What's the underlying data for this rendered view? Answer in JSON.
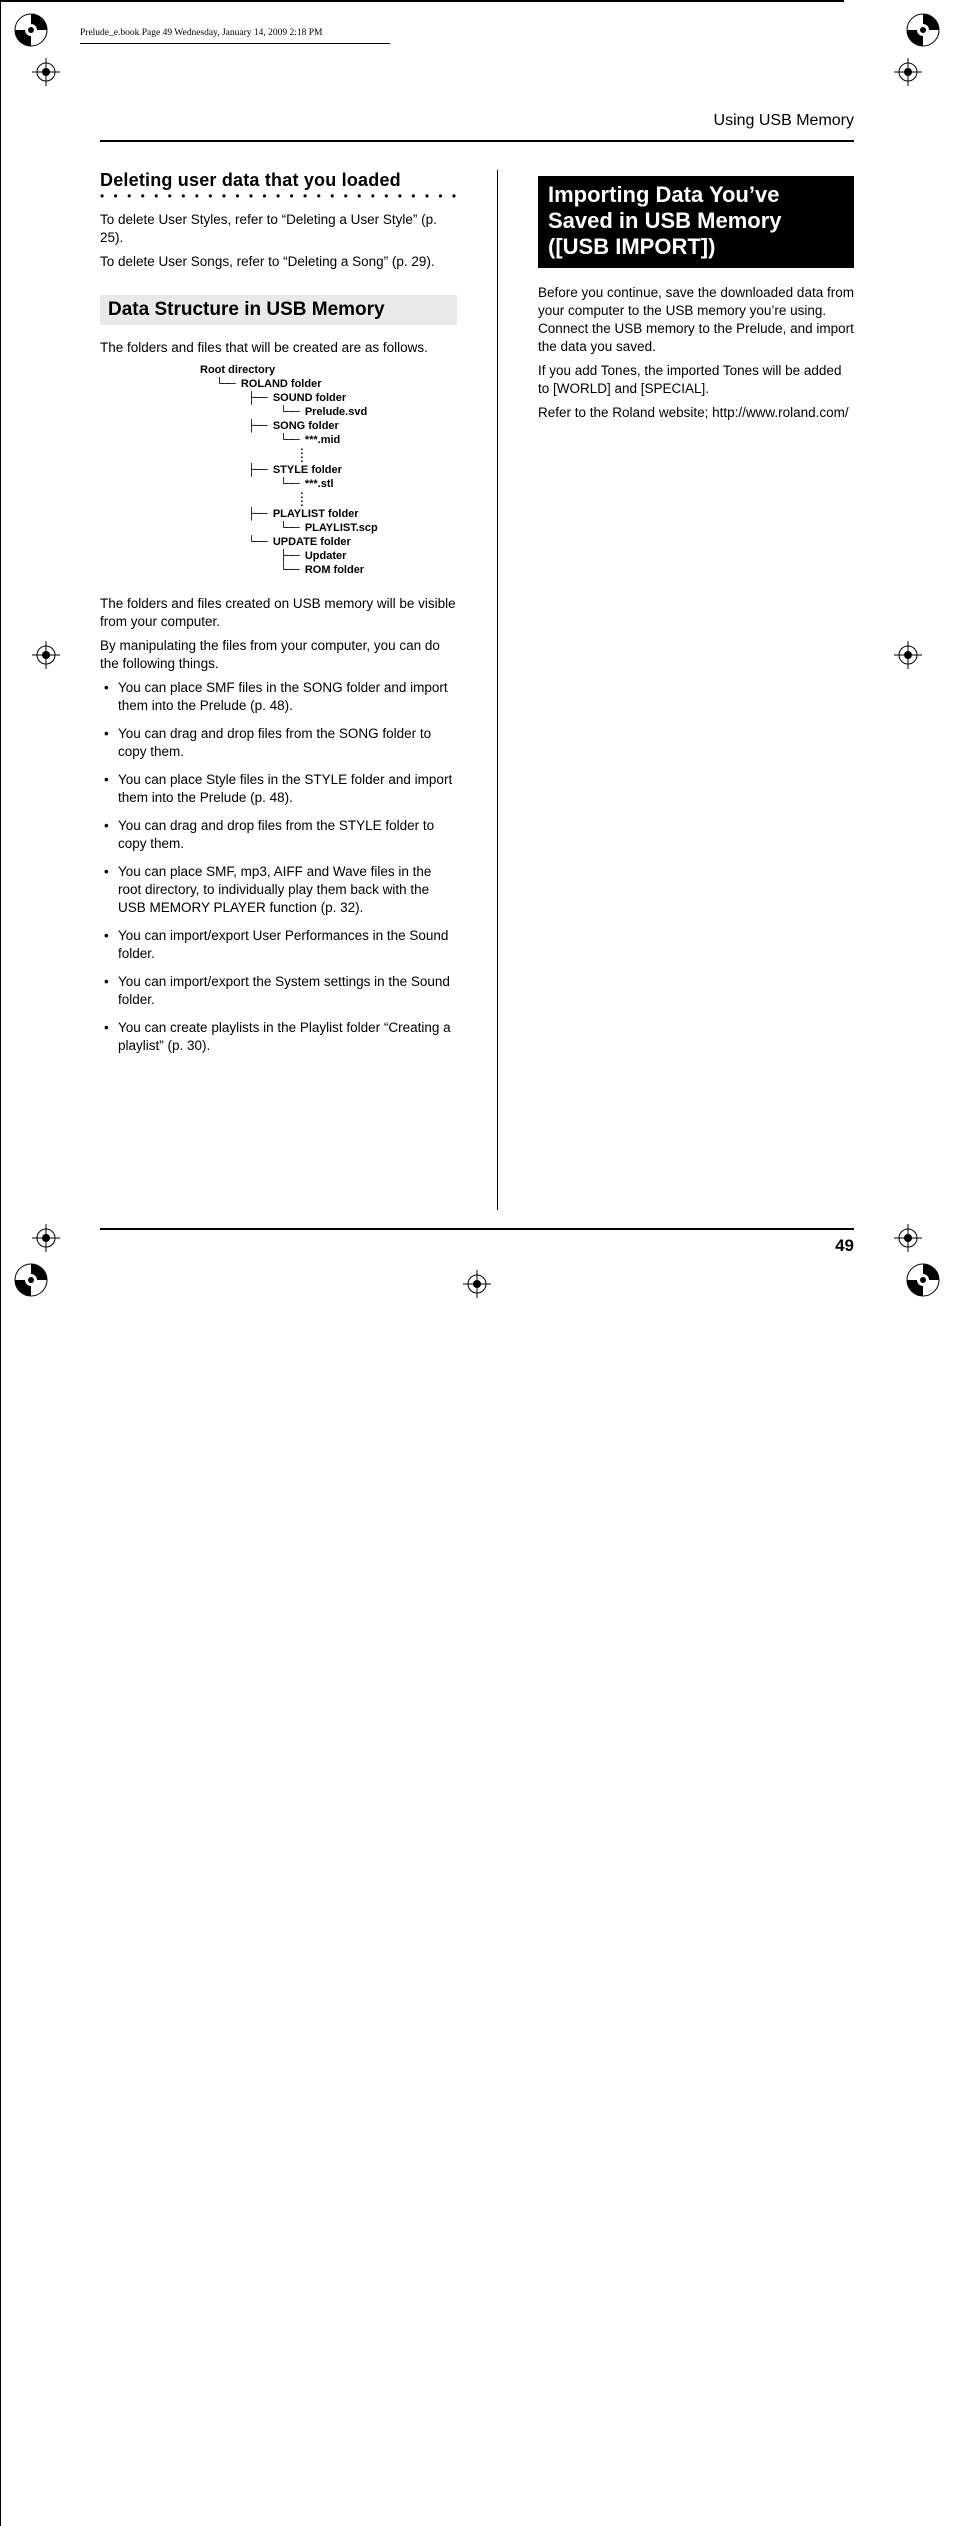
{
  "meta": {
    "ebook_header": "Prelude_e.book  Page 49  Wednesday, January 14, 2009  2:18 PM",
    "running_head": "Using USB Memory",
    "page_number": "49"
  },
  "left": {
    "heading1": "Deleting user data that you loaded",
    "p1": "To delete User Styles, refer to “Deleting a User Style” (p. 25).",
    "p2": "To delete User Songs, refer to “Deleting a Song” (p. 29).",
    "subhead": "Data Structure in USB Memory",
    "p3": "The folders and files that will be created are as follows.",
    "tree": {
      "root": "Root directory",
      "roland": "ROLAND folder",
      "sound": "SOUND folder",
      "sound_file": "Prelude.svd",
      "song": "SONG folder",
      "song_file": "***.mid",
      "style": "STYLE folder",
      "style_file": "***.stl",
      "playlist": "PLAYLIST folder",
      "playlist_file": "PLAYLIST.scp",
      "update": "UPDATE folder",
      "update_file": "Updater",
      "rom": "ROM folder"
    },
    "p4": "The folders and files created on USB memory will be visible from your computer.",
    "p5": "By manipulating the files from your computer, you can do the following things.",
    "bullets": [
      "You can place SMF files in the SONG folder and import them into the Prelude (p. 48).",
      "You can drag and drop files from the SONG folder to copy them.",
      "You can place Style files in the STYLE folder and import them into the Prelude (p. 48).",
      "You can drag and drop files from the STYLE folder to copy them.",
      "You can place SMF, mp3, AIFF and Wave files in the root directory, to individually play them back with the USB MEMORY PLAYER function (p. 32).",
      "You can import/export User Performances in the Sound folder.",
      "You can import/export the System settings in the Sound folder.",
      "You can create playlists in the Playlist folder “Creating a playlist” (p. 30)."
    ]
  },
  "right": {
    "heading": "Importing Data You’ve Saved in USB Memory ([USB IMPORT])",
    "p1": "Before you continue, save the downloaded data from your computer to the USB memory you’re using. Connect the USB memory to the Prelude, and import the data you saved.",
    "p2": "If you add Tones, the imported Tones will be added to [WORLD] and [SPECIAL].",
    "p3": "Refer to the Roland website; http://www.roland.com/"
  }
}
